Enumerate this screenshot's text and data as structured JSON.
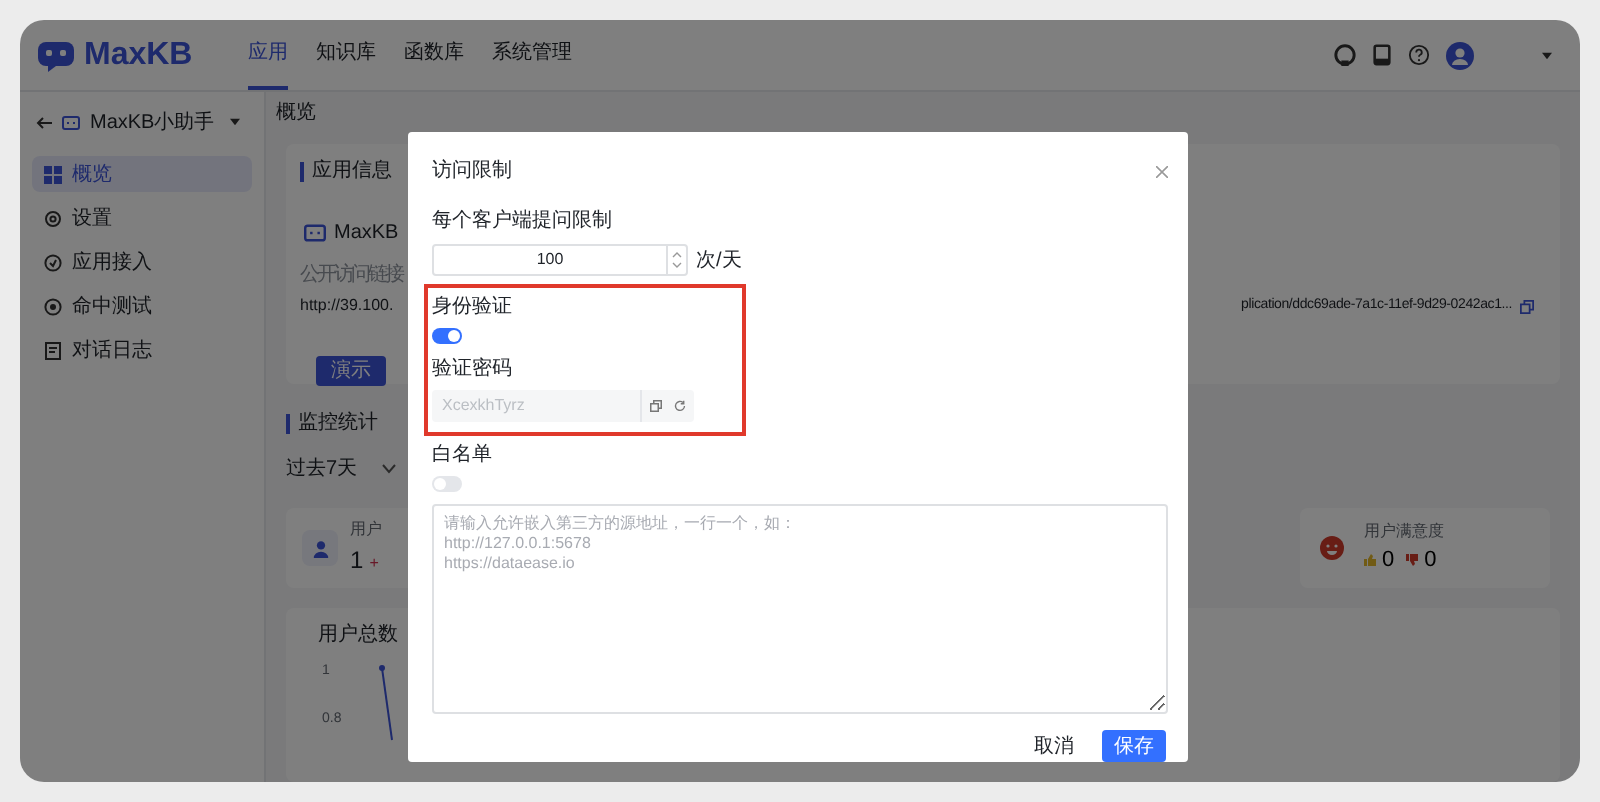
{
  "header": {
    "logo": "MaxKB",
    "nav": [
      {
        "label": "应用",
        "selected": true
      },
      {
        "label": "知识库",
        "selected": false
      },
      {
        "label": "函数库",
        "selected": false
      },
      {
        "label": "系统管理",
        "selected": false
      }
    ]
  },
  "sidebar": {
    "app_name": "MaxKB小助手",
    "items": [
      {
        "label": "概览",
        "selected": true
      },
      {
        "label": "设置",
        "selected": false
      },
      {
        "label": "应用接入",
        "selected": false
      },
      {
        "label": "命中测试",
        "selected": false
      },
      {
        "label": "对话日志",
        "selected": false
      }
    ]
  },
  "page_title": "概览",
  "app_info": {
    "title": "应用信息",
    "name": "MaxKB",
    "link_label": "公开访问链接",
    "link_left": "http://39.100.",
    "link_right": "plication/ddc69ade-7a1c-11ef-9d29-0242ac1...",
    "demo_button": "演示"
  },
  "monitoring": {
    "title": "监控统计",
    "range": "过去7天",
    "user_label": "用户",
    "user_count": "1",
    "user_delta": "+",
    "satisfaction_label": "用户满意度",
    "likes": "0",
    "dislikes": "0",
    "chart_title": "用户总数",
    "ticks": [
      "1",
      "0.8"
    ]
  },
  "dialog": {
    "title": "访问限制",
    "limit_label": "每个客户端提问限制",
    "limit_value": "100",
    "limit_unit": "次/天",
    "auth_label": "身份验证",
    "auth_on": true,
    "password_label": "验证密码",
    "password": "XcexkhTyrz",
    "whitelist_label": "白名单",
    "whitelist_on": false,
    "whitelist_placeholder": "请输入允许嵌入第三方的源地址，一行一个，如：\nhttp://127.0.0.1:5678\nhttps://dataease.io",
    "buttons": [
      {
        "label": "取消",
        "kind": "secondary"
      },
      {
        "label": "保存",
        "kind": "primary"
      }
    ]
  }
}
